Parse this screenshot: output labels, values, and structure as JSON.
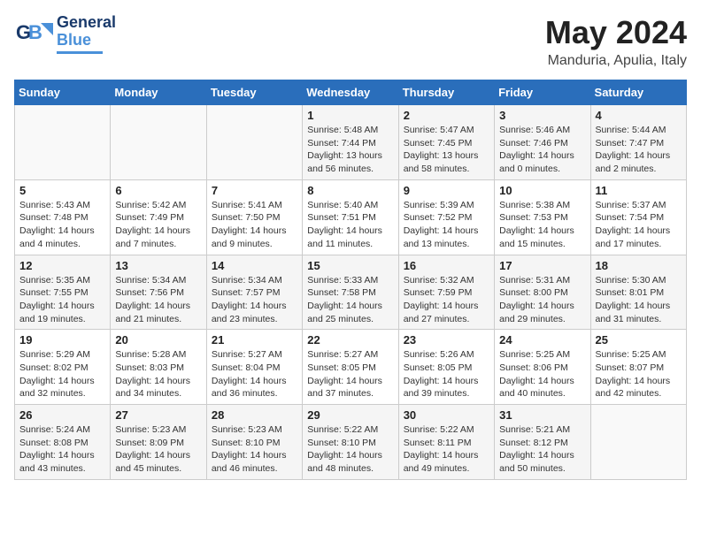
{
  "logo": {
    "line1": "General",
    "line2": "Blue"
  },
  "title": "May 2024",
  "subtitle": "Manduria, Apulia, Italy",
  "weekdays": [
    "Sunday",
    "Monday",
    "Tuesday",
    "Wednesday",
    "Thursday",
    "Friday",
    "Saturday"
  ],
  "weeks": [
    [
      {
        "day": "",
        "info": ""
      },
      {
        "day": "",
        "info": ""
      },
      {
        "day": "",
        "info": ""
      },
      {
        "day": "1",
        "info": "Sunrise: 5:48 AM\nSunset: 7:44 PM\nDaylight: 13 hours\nand 56 minutes."
      },
      {
        "day": "2",
        "info": "Sunrise: 5:47 AM\nSunset: 7:45 PM\nDaylight: 13 hours\nand 58 minutes."
      },
      {
        "day": "3",
        "info": "Sunrise: 5:46 AM\nSunset: 7:46 PM\nDaylight: 14 hours\nand 0 minutes."
      },
      {
        "day": "4",
        "info": "Sunrise: 5:44 AM\nSunset: 7:47 PM\nDaylight: 14 hours\nand 2 minutes."
      }
    ],
    [
      {
        "day": "5",
        "info": "Sunrise: 5:43 AM\nSunset: 7:48 PM\nDaylight: 14 hours\nand 4 minutes."
      },
      {
        "day": "6",
        "info": "Sunrise: 5:42 AM\nSunset: 7:49 PM\nDaylight: 14 hours\nand 7 minutes."
      },
      {
        "day": "7",
        "info": "Sunrise: 5:41 AM\nSunset: 7:50 PM\nDaylight: 14 hours\nand 9 minutes."
      },
      {
        "day": "8",
        "info": "Sunrise: 5:40 AM\nSunset: 7:51 PM\nDaylight: 14 hours\nand 11 minutes."
      },
      {
        "day": "9",
        "info": "Sunrise: 5:39 AM\nSunset: 7:52 PM\nDaylight: 14 hours\nand 13 minutes."
      },
      {
        "day": "10",
        "info": "Sunrise: 5:38 AM\nSunset: 7:53 PM\nDaylight: 14 hours\nand 15 minutes."
      },
      {
        "day": "11",
        "info": "Sunrise: 5:37 AM\nSunset: 7:54 PM\nDaylight: 14 hours\nand 17 minutes."
      }
    ],
    [
      {
        "day": "12",
        "info": "Sunrise: 5:35 AM\nSunset: 7:55 PM\nDaylight: 14 hours\nand 19 minutes."
      },
      {
        "day": "13",
        "info": "Sunrise: 5:34 AM\nSunset: 7:56 PM\nDaylight: 14 hours\nand 21 minutes."
      },
      {
        "day": "14",
        "info": "Sunrise: 5:34 AM\nSunset: 7:57 PM\nDaylight: 14 hours\nand 23 minutes."
      },
      {
        "day": "15",
        "info": "Sunrise: 5:33 AM\nSunset: 7:58 PM\nDaylight: 14 hours\nand 25 minutes."
      },
      {
        "day": "16",
        "info": "Sunrise: 5:32 AM\nSunset: 7:59 PM\nDaylight: 14 hours\nand 27 minutes."
      },
      {
        "day": "17",
        "info": "Sunrise: 5:31 AM\nSunset: 8:00 PM\nDaylight: 14 hours\nand 29 minutes."
      },
      {
        "day": "18",
        "info": "Sunrise: 5:30 AM\nSunset: 8:01 PM\nDaylight: 14 hours\nand 31 minutes."
      }
    ],
    [
      {
        "day": "19",
        "info": "Sunrise: 5:29 AM\nSunset: 8:02 PM\nDaylight: 14 hours\nand 32 minutes."
      },
      {
        "day": "20",
        "info": "Sunrise: 5:28 AM\nSunset: 8:03 PM\nDaylight: 14 hours\nand 34 minutes."
      },
      {
        "day": "21",
        "info": "Sunrise: 5:27 AM\nSunset: 8:04 PM\nDaylight: 14 hours\nand 36 minutes."
      },
      {
        "day": "22",
        "info": "Sunrise: 5:27 AM\nSunset: 8:05 PM\nDaylight: 14 hours\nand 37 minutes."
      },
      {
        "day": "23",
        "info": "Sunrise: 5:26 AM\nSunset: 8:05 PM\nDaylight: 14 hours\nand 39 minutes."
      },
      {
        "day": "24",
        "info": "Sunrise: 5:25 AM\nSunset: 8:06 PM\nDaylight: 14 hours\nand 40 minutes."
      },
      {
        "day": "25",
        "info": "Sunrise: 5:25 AM\nSunset: 8:07 PM\nDaylight: 14 hours\nand 42 minutes."
      }
    ],
    [
      {
        "day": "26",
        "info": "Sunrise: 5:24 AM\nSunset: 8:08 PM\nDaylight: 14 hours\nand 43 minutes."
      },
      {
        "day": "27",
        "info": "Sunrise: 5:23 AM\nSunset: 8:09 PM\nDaylight: 14 hours\nand 45 minutes."
      },
      {
        "day": "28",
        "info": "Sunrise: 5:23 AM\nSunset: 8:10 PM\nDaylight: 14 hours\nand 46 minutes."
      },
      {
        "day": "29",
        "info": "Sunrise: 5:22 AM\nSunset: 8:10 PM\nDaylight: 14 hours\nand 48 minutes."
      },
      {
        "day": "30",
        "info": "Sunrise: 5:22 AM\nSunset: 8:11 PM\nDaylight: 14 hours\nand 49 minutes."
      },
      {
        "day": "31",
        "info": "Sunrise: 5:21 AM\nSunset: 8:12 PM\nDaylight: 14 hours\nand 50 minutes."
      },
      {
        "day": "",
        "info": ""
      }
    ]
  ]
}
